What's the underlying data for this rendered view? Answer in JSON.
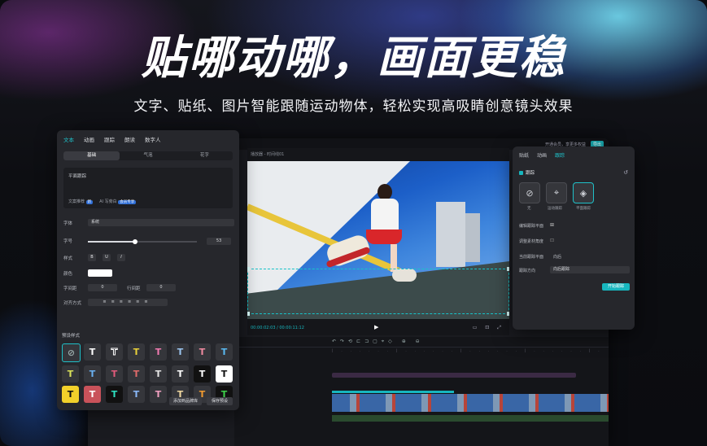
{
  "headline": "贴哪动哪，画面更稳",
  "subheadline": "文字、贴纸、图片智能跟随运动物体，轻松实现高吸睛创意镜头效果",
  "window_top": {
    "right_text": "开通会员，享更多权益",
    "right_button": "导出"
  },
  "text_panel": {
    "tabs": [
      {
        "label": "文本",
        "active": true
      },
      {
        "label": "动画"
      },
      {
        "label": "跟踪"
      },
      {
        "label": "朗读"
      },
      {
        "label": "数字人"
      }
    ],
    "segments": [
      {
        "label": "基础",
        "active": true
      },
      {
        "label": "气泡"
      },
      {
        "label": "花字"
      }
    ],
    "text_value": "平面跟踪",
    "chip1_label": "文案推荐",
    "chip1_badge": "新",
    "chip2_label": "AI 写旁白",
    "chip2_badge": "会员专享",
    "font_label": "字体",
    "font_value": "系统",
    "size_label": "字号",
    "size_value": "53",
    "size_fraction": 0.43,
    "style_label": "样式",
    "style_buttons": [
      "B",
      "U",
      "I"
    ],
    "color_label": "颜色",
    "color_value": "#ffffff",
    "spacing_label": "字间距",
    "spacing_value": "0",
    "line_label": "行间距",
    "line_value": "0",
    "align_label": "对齐方式",
    "presets_label": "预设样式",
    "add_button": "添加到品牌库",
    "save_button": "保存预设"
  },
  "player": {
    "title": "播放器 - 时间线01",
    "timecode": "00:00:02:03 / 00:00:11:12",
    "play_icon": "play-icon"
  },
  "track_panel": {
    "tabs": [
      {
        "label": "贴纸"
      },
      {
        "label": "动画"
      },
      {
        "label": "跟踪",
        "active": true
      }
    ],
    "section": "跟踪",
    "modes": [
      {
        "label": "无",
        "icon": "none-icon"
      },
      {
        "label": "运动跟踪",
        "icon": "motion-track-icon"
      },
      {
        "label": "平面跟踪",
        "icon": "plane-track-icon",
        "active": true
      }
    ],
    "row1": "编辑跟踪平面",
    "row2": "调整素材角度",
    "row3_label": "当前跟踪平面",
    "row3_value": "向后",
    "row4_label": "跟踪方向",
    "row4_value": "向后跟踪",
    "start_button": "开始跟踪"
  },
  "colors": {
    "accent": "#1fc0c8",
    "panel": "#26272c",
    "bg": "#0b0c10"
  }
}
